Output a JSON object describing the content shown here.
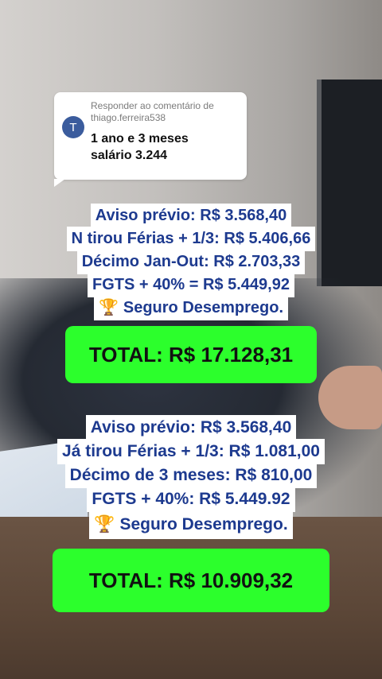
{
  "reply": {
    "avatar_letter": "T",
    "line1": "Responder ao comentário de",
    "line2": "thiago.ferreira538",
    "text1": "1 ano e 3 meses",
    "text2": "salário 3.244"
  },
  "block1": [
    "Aviso prévio: R$ 3.568,40",
    "N tirou Férias + 1/3:  R$ 5.406,66",
    "Décimo Jan-Out: R$ 2.703,33",
    "FGTS + 40% = R$ 5.449,92",
    "Seguro Desemprego."
  ],
  "total1": "TOTAL: R$ 17.128,31",
  "block2": [
    "Aviso prévio: R$ 3.568,40",
    "Já tirou Férias + 1/3:  R$ 1.081,00",
    "Décimo de 3 meses: R$ 810,00",
    "FGTS + 40%: R$ 5.449.92",
    "Seguro Desemprego."
  ],
  "total2": "TOTAL: R$ 10.909,32",
  "icons": {
    "trophy": "trophy-icon"
  },
  "colors": {
    "text_blue": "#1d3a8f",
    "total_green": "#2cff2c",
    "avatar": "#3b5c9d"
  }
}
